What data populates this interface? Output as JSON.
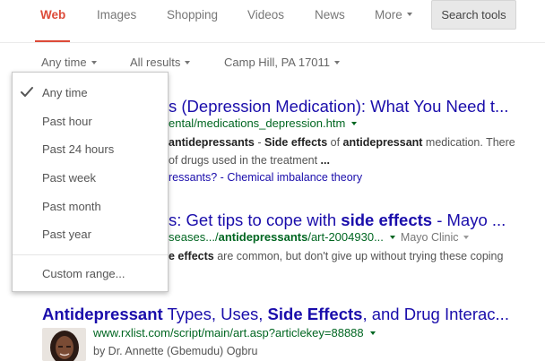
{
  "nav": {
    "tabs": [
      {
        "label": "Web",
        "active": true
      },
      {
        "label": "Images"
      },
      {
        "label": "Shopping"
      },
      {
        "label": "Videos"
      },
      {
        "label": "News"
      },
      {
        "label": "More"
      }
    ],
    "search_tools_label": "Search tools"
  },
  "filters": {
    "time": "Any time",
    "results": "All results",
    "location": "Camp Hill, PA 17011"
  },
  "time_menu": {
    "items": [
      "Any time",
      "Past hour",
      "Past 24 hours",
      "Past week",
      "Past month",
      "Past year"
    ],
    "selected": "Any time",
    "custom_range": "Custom range..."
  },
  "results": [
    {
      "title_visible": "s (Depression Medication): What You Need t...",
      "url_visible": "ental/medications_depression.htm",
      "snippet_lines": [
        [
          "antidepressants",
          " - ",
          "Side effects",
          " of ",
          "antidepressant",
          " medication. There"
        ],
        [
          "of drugs used in the treatment ",
          "..."
        ]
      ],
      "sitelinks_visible": "ressants? - ",
      "sitelink": "Chemical imbalance theory"
    },
    {
      "title_visible_parts": [
        "s",
        ": Get tips to cope with ",
        "side effects",
        " - Mayo ..."
      ],
      "url_visible_parts": [
        "seases.../",
        "antidepressants",
        "/art-2004930..."
      ],
      "source": "Mayo Clinic",
      "snippet_parts": [
        "e effects",
        " are common, but don't give up without trying these coping"
      ]
    },
    {
      "title_parts": [
        "Antidepressant",
        " Types, Uses, ",
        "Side Effects",
        ", and Drug Interac..."
      ],
      "url": "www.rxlist.com/script/main/art.asp?articlekey=88888",
      "author": "by Dr. Annette (Gbemudu) Ogbru"
    }
  ],
  "colors": {
    "accent_red": "#dd4b39",
    "link_blue": "#1a0dab",
    "url_green": "#006621"
  }
}
